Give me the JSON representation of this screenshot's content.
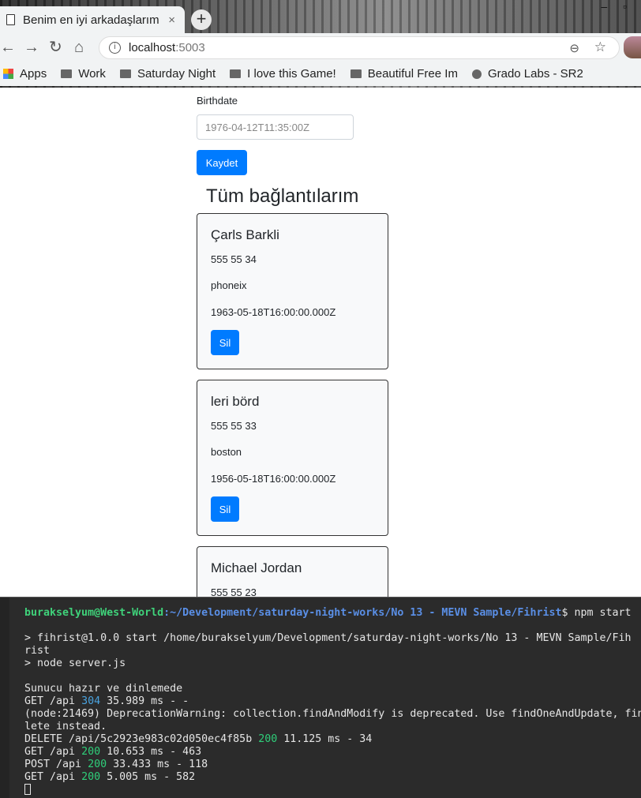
{
  "browser": {
    "tab_title": "Benim en iyi arkadaşlarım",
    "tab_close": "×",
    "new_tab": "+",
    "url_host": "localhost",
    "url_port": ":5003",
    "bookmarks": [
      "Apps",
      "Work",
      "Saturday Night",
      "I love this Game!",
      "Beautiful Free Im",
      "Grado Labs - SR2"
    ]
  },
  "form": {
    "birthdate_label": "Birthdate",
    "birthdate_placeholder": "1976-04-12T11:35:00Z",
    "save_label": "Kaydet"
  },
  "contacts": {
    "heading": "Tüm bağlantılarım",
    "delete_label": "Sil",
    "items": [
      {
        "name": "Çarls Barkli",
        "phone": "555 55 34",
        "city": "phoneix",
        "birthdate": "1963-05-18T16:00:00.000Z"
      },
      {
        "name": "leri börd",
        "phone": "555 55 33",
        "city": "boston",
        "birthdate": "1956-05-18T16:00:00.000Z"
      },
      {
        "name": "Michael Jordan",
        "phone": "555 55 23",
        "city": "",
        "birthdate": ""
      }
    ]
  },
  "terminal": {
    "prompt_user": "burakselyum@West-World",
    "prompt_path": ":~/Development/saturday-night-works/No 13 - MEVN Sample/Fihrist",
    "prompt_cmd": "$ npm start",
    "start_line": "> fihrist@1.0.0 start /home/burakselyum/Development/saturday-night-works/No 13 - MEVN Sample/Fih",
    "start_line_wrap": "rist",
    "node_line": "> node server.js",
    "ready_line": "Sunucu hazır ve dinlemede",
    "log1_pre": "GET /api ",
    "log1_status": "304",
    "log1_post": " 35.989 ms - -",
    "warn_line": "(node:21469) DeprecationWarning: collection.findAndModify is deprecated. Use findOneAndUpdate, fin",
    "warn_line_wrap": "lete instead.",
    "log2_pre": "DELETE /api/5c2923e983c02d050ec4f85b ",
    "log2_status": "200",
    "log2_post": " 11.125 ms - 34",
    "log3_pre": "GET /api ",
    "log3_status": "200",
    "log3_post": " 10.653 ms - 463",
    "log4_pre": "POST /api ",
    "log4_status": "200",
    "log4_post": " 33.433 ms - 118",
    "log5_pre": "GET /api ",
    "log5_status": "200",
    "log5_post": " 5.005 ms - 582"
  }
}
